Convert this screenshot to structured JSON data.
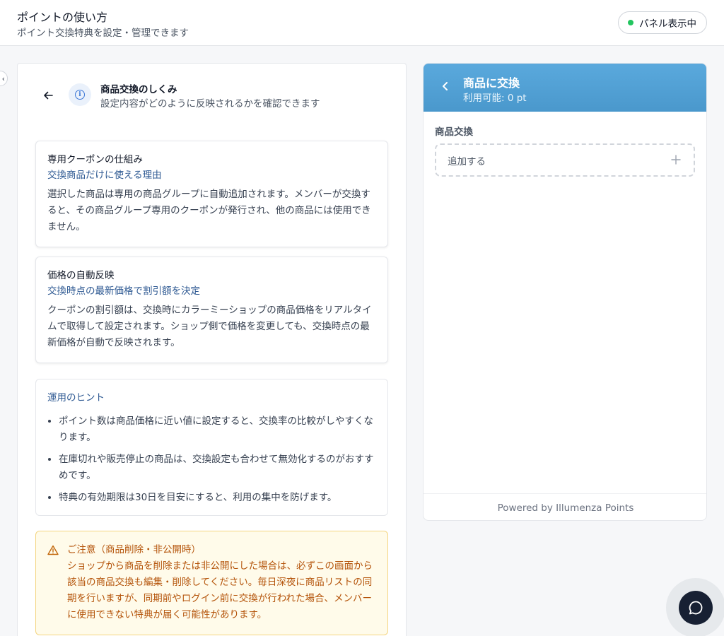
{
  "header": {
    "title": "ポイントの使い方",
    "subtitle": "ポイント交換特典を設定・管理できます",
    "status_label": "パネル表示中",
    "status_color": "#22c55e"
  },
  "left_panel": {
    "title": "商品交換のしくみ",
    "description": "設定内容がどのように反映されるかを確認できます",
    "cards": [
      {
        "title": "専用クーポンの仕組み",
        "subtitle": "交換商品だけに使える理由",
        "body": "選択した商品は専用の商品グループに自動追加されます。メンバーが交換すると、その商品グループ専用のクーポンが発行され、他の商品には使用できません。"
      },
      {
        "title": "価格の自動反映",
        "subtitle": "交換時点の最新価格で割引額を決定",
        "body": "クーポンの割引額は、交換時にカラーミーショップの商品価格をリアルタイムで取得して設定されます。ショップ側で価格を変更しても、交換時点の最新価格が自動で反映されます。"
      }
    ],
    "tips": {
      "title": "運用のヒント",
      "items": [
        "ポイント数は商品価格に近い値に設定すると、交換率の比較がしやすくなります。",
        "在庫切れや販売停止の商品は、交換設定も合わせて無効化するのがおすすめです。",
        "特典の有効期限は30日を目安にすると、利用の集中を防げます。"
      ]
    },
    "warning": {
      "title": "ご注意（商品削除・非公開時）",
      "body": "ショップから商品を削除または非公開にした場合は、必ずこの画面から該当の商品交換も編集・削除してください。毎日深夜に商品リストの同期を行いますが、同期前やログイン前に交換が行われた場合、メンバーに使用できない特典が届く可能性があります。",
      "color": "#b45309"
    }
  },
  "right_panel": {
    "title": "商品に交換",
    "points_label": "利用可能: 0 pt",
    "section_label": "商品交換",
    "add_label": "追加する",
    "footer": "Powered by Illumenza Points",
    "accent": "#4fa1d6"
  },
  "icons": {
    "back": "arrow-left-icon",
    "info": "info-icon",
    "warning": "warning-triangle-icon",
    "plus": "plus-icon",
    "chat": "chat-bubble-icon"
  }
}
